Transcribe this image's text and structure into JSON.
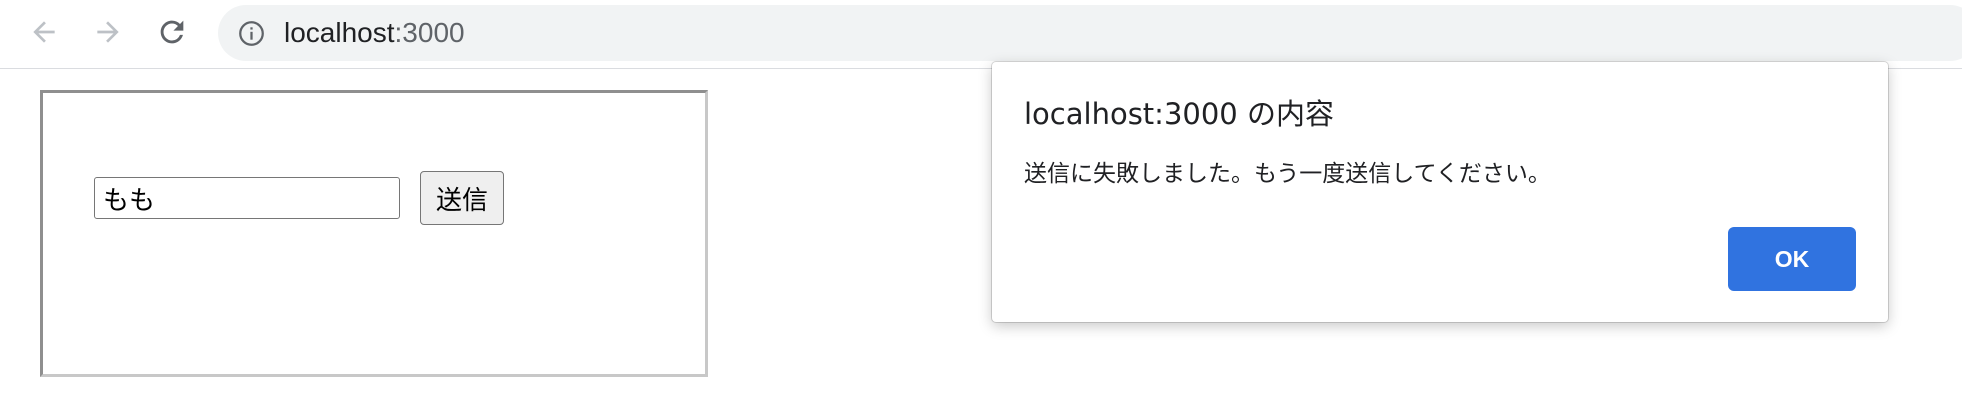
{
  "browser": {
    "url_host": "localhost",
    "url_port": ":3000",
    "icons": {
      "back": "arrow-left-icon",
      "forward": "arrow-right-icon",
      "reload": "reload-icon",
      "site_info": "info-icon"
    }
  },
  "form": {
    "input_value": "もも",
    "submit_label": "送信"
  },
  "dialog": {
    "title": "localhost:3000 の内容",
    "message": "送信に失敗しました。もう一度送信してください。",
    "ok_label": "OK",
    "ok_color": "#3073e0"
  }
}
